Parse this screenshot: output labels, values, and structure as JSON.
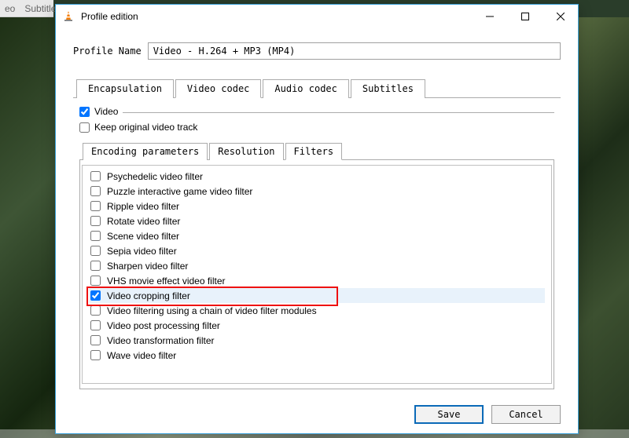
{
  "background": {
    "menu_eo": "eo",
    "menu_subtitle": "Subtitle"
  },
  "dialog": {
    "title": "Profile edition",
    "profile_label": "Profile Name",
    "profile_value": "Video - H.264 + MP3 (MP4)",
    "outer_tabs": [
      "Encapsulation",
      "Video codec",
      "Audio codec",
      "Subtitles"
    ],
    "outer_active_index": 1,
    "video_check_label": "Video",
    "video_checked": true,
    "keep_original_label": "Keep original video track",
    "keep_original_checked": false,
    "inner_tabs": [
      "Encoding parameters",
      "Resolution",
      "Filters"
    ],
    "inner_active_index": 2,
    "filters": [
      {
        "label": "Psychedelic video filter",
        "checked": false
      },
      {
        "label": "Puzzle interactive game video filter",
        "checked": false
      },
      {
        "label": "Ripple video filter",
        "checked": false
      },
      {
        "label": "Rotate video filter",
        "checked": false
      },
      {
        "label": "Scene video filter",
        "checked": false
      },
      {
        "label": "Sepia video filter",
        "checked": false
      },
      {
        "label": "Sharpen video filter",
        "checked": false
      },
      {
        "label": "VHS movie effect video filter",
        "checked": false
      },
      {
        "label": "Video cropping filter",
        "checked": true,
        "selected": true
      },
      {
        "label": "Video filtering using a chain of video filter modules",
        "checked": false
      },
      {
        "label": "Video post processing filter",
        "checked": false
      },
      {
        "label": "Video transformation filter",
        "checked": false
      },
      {
        "label": "Wave video filter",
        "checked": false
      }
    ],
    "save_label": "Save",
    "cancel_label": "Cancel"
  }
}
